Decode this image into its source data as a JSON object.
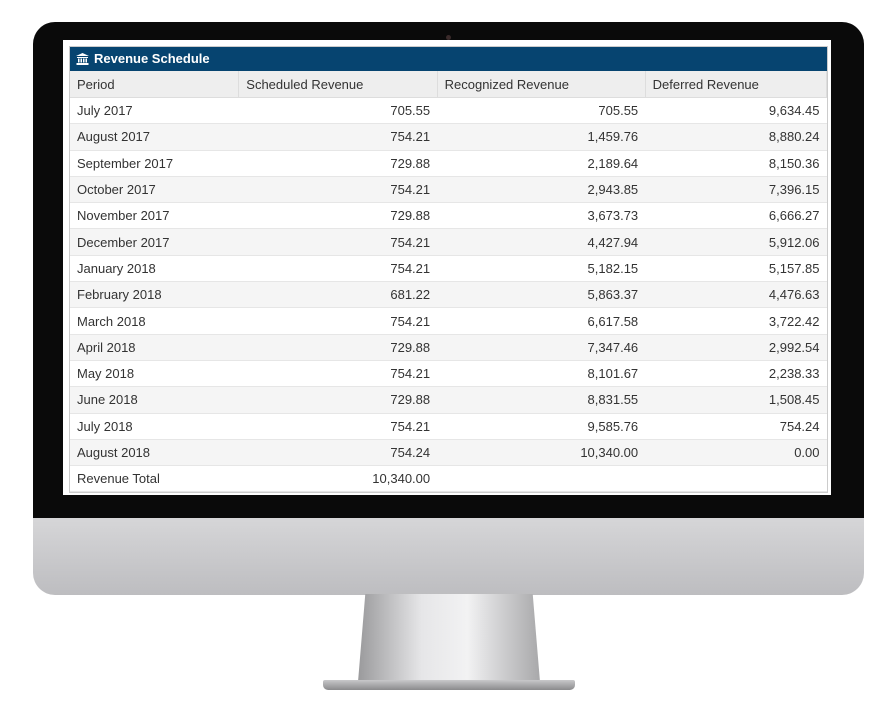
{
  "panel": {
    "title": "Revenue Schedule",
    "icon": "bank-icon"
  },
  "columns": [
    "Period",
    "Scheduled Revenue",
    "Recognized Revenue",
    "Deferred Revenue"
  ],
  "rows": [
    [
      "July 2017",
      "705.55",
      "705.55",
      "9,634.45"
    ],
    [
      "August 2017",
      "754.21",
      "1,459.76",
      "8,880.24"
    ],
    [
      "September 2017",
      "729.88",
      "2,189.64",
      "8,150.36"
    ],
    [
      "October 2017",
      "754.21",
      "2,943.85",
      "7,396.15"
    ],
    [
      "November 2017",
      "729.88",
      "3,673.73",
      "6,666.27"
    ],
    [
      "December 2017",
      "754.21",
      "4,427.94",
      "5,912.06"
    ],
    [
      "January 2018",
      "754.21",
      "5,182.15",
      "5,157.85"
    ],
    [
      "February 2018",
      "681.22",
      "5,863.37",
      "4,476.63"
    ],
    [
      "March 2018",
      "754.21",
      "6,617.58",
      "3,722.42"
    ],
    [
      "April 2018",
      "729.88",
      "7,347.46",
      "2,992.54"
    ],
    [
      "May 2018",
      "754.21",
      "8,101.67",
      "2,238.33"
    ],
    [
      "June 2018",
      "729.88",
      "8,831.55",
      "1,508.45"
    ],
    [
      "July 2018",
      "754.21",
      "9,585.76",
      "754.24"
    ],
    [
      "August 2018",
      "754.24",
      "10,340.00",
      "0.00"
    ]
  ],
  "total": {
    "label": "Revenue Total",
    "scheduled": "10,340.00"
  }
}
